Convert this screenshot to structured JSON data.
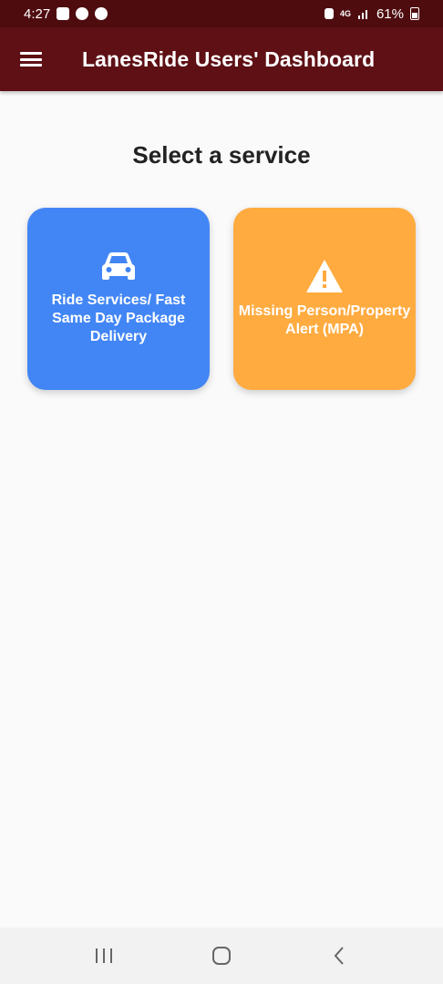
{
  "status_bar": {
    "time": "4:27",
    "network": "4G",
    "battery": "61%"
  },
  "app_bar": {
    "title": "LanesRide Users' Dashboard"
  },
  "main": {
    "title": "Select a service",
    "services": [
      {
        "label": "Ride Services/ Fast Same Day Package Delivery",
        "icon": "car-icon",
        "color": "#4286f5"
      },
      {
        "label": "Missing Person/Property Alert (MPA)",
        "icon": "warning-icon",
        "color": "#ffab40"
      }
    ]
  },
  "colors": {
    "status_bar": "#4e0c0f",
    "app_bar": "#5e1015",
    "background": "#fafafa"
  }
}
